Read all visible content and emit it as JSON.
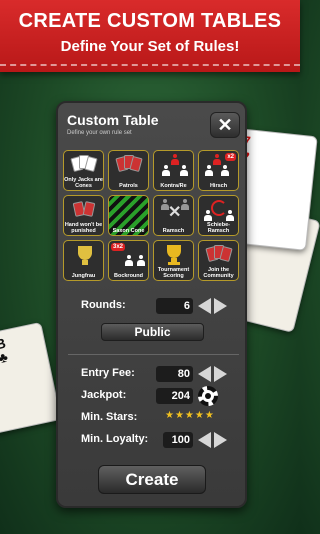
{
  "banner": {
    "title": "CREATE CUSTOM TABLES",
    "subtitle": "Define Your Set of Rules!"
  },
  "background_cards": {
    "top_right_index": "7",
    "top_right_suit": "♥",
    "bottom_left_index": "B",
    "bottom_left_suit": "♣"
  },
  "dialog": {
    "title": "Custom Table",
    "subtitle": "Define your own rule set",
    "close_label": "✕",
    "rules": [
      {
        "label": "Only Jacks are Cones"
      },
      {
        "label": "Patrols"
      },
      {
        "label": "Kontra/Re"
      },
      {
        "label": "Hirsch",
        "badge": "x2"
      },
      {
        "label": "Hand won't be punished"
      },
      {
        "label": "Saxon Cone"
      },
      {
        "label": "Ramsch"
      },
      {
        "label": "Schiebe-Ramsch"
      },
      {
        "label": "Jungfrau"
      },
      {
        "label": "Bockround",
        "badge": "3x2"
      },
      {
        "label": "Tournament Scoring"
      },
      {
        "label": "Join the Community"
      }
    ],
    "rounds": {
      "label": "Rounds:",
      "value": "6"
    },
    "visibility_button": "Public",
    "entry_fee": {
      "label": "Entry Fee:",
      "value": "80"
    },
    "jackpot": {
      "label": "Jackpot:",
      "value": "204"
    },
    "min_stars": {
      "label": "Min. Stars:",
      "stars": "★★★★★",
      "rating": 5
    },
    "min_loyalty": {
      "label": "Min. Loyalty:",
      "value": "100"
    },
    "create_button": "Create"
  },
  "colors": {
    "banner_red": "#c81e1e",
    "table_green": "#1d4a26",
    "panel_gray": "#404040",
    "tile_border_gold": "#b59a2a",
    "star_gold": "#f0c020"
  }
}
